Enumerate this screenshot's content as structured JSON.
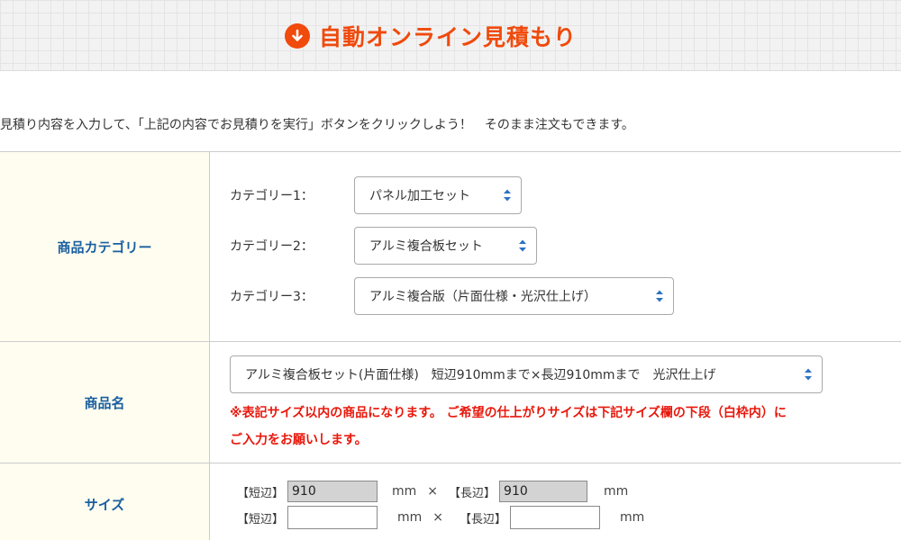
{
  "header": {
    "title": "自動オンライン見積もり",
    "icon": "arrow-down-circle-icon",
    "accent_color": "#f04a0c"
  },
  "intro_text": "見積り内容を入力して、「上記の内容でお見積りを実行」ボタンをクリックしよう！　そのまま注文もできます。",
  "category": {
    "label": "商品カテゴリー",
    "items": [
      {
        "label": "カテゴリー1：",
        "value": "パネル加工セット"
      },
      {
        "label": "カテゴリー2：",
        "value": "アルミ複合板セット"
      },
      {
        "label": "カテゴリー3：",
        "value": "アルミ複合版（片面仕様・光沢仕上げ）"
      }
    ]
  },
  "product": {
    "label": "商品名",
    "value": "アルミ複合板セット(片面仕様)　短辺910mmまで×長辺910mmまで　光沢仕上げ",
    "note_line1": "※表記サイズ以内の商品になります。 ご希望の仕上がりサイズは下記サイズ欄の下段（白枠内）に",
    "note_line2": "ご入力をお願いします。",
    "note_color": "#e8180c"
  },
  "size": {
    "label": "サイズ",
    "short_tag": "【短辺】",
    "long_tag": "【長辺】",
    "unit": "mm",
    "times": "×",
    "fixed_short": "910",
    "fixed_long": "910",
    "input_short": "",
    "input_long": ""
  }
}
